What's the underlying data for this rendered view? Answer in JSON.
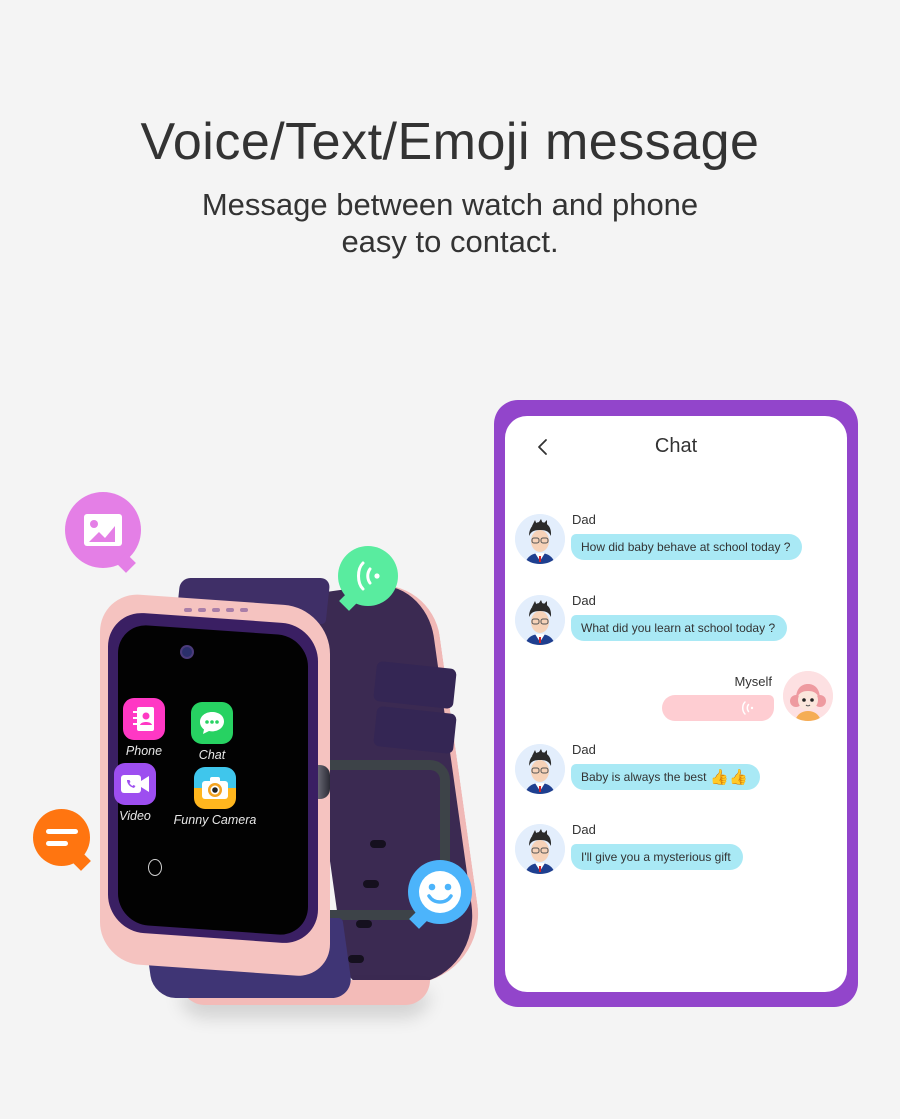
{
  "header": {
    "title": "Voice/Text/Emoji message",
    "subtitle_line1": "Message between watch and phone",
    "subtitle_line2": "easy to contact."
  },
  "watch": {
    "apps": [
      {
        "label": "Phone",
        "icon": "contacts-book-icon",
        "color": "#ff38c4"
      },
      {
        "label": "Chat",
        "icon": "chat-dots-icon",
        "color": "#27d262"
      },
      {
        "label": "Video",
        "icon": "video-call-icon",
        "color": "#9d4ef0"
      },
      {
        "label": "Funny Camera",
        "icon": "camera-icon",
        "color": "#3fc6ec"
      }
    ]
  },
  "floating_icons": [
    {
      "name": "image-message-icon",
      "color": "#e47fe6"
    },
    {
      "name": "voice-message-icon",
      "color": "#59ec9f"
    },
    {
      "name": "text-message-icon",
      "color": "#ff7510"
    },
    {
      "name": "emoji-message-icon",
      "color": "#4cb4fb"
    }
  ],
  "chat": {
    "title": "Chat",
    "back_icon": "chevron-left-icon",
    "frame_color": "#9245cb",
    "bubble_color": "#a9e9f5",
    "voice_bubble_color": "#fecdd2",
    "messages": [
      {
        "sender": "Dad",
        "side": "left",
        "type": "text",
        "text": "How did baby behave at school today ?"
      },
      {
        "sender": "Dad",
        "side": "left",
        "type": "text",
        "text": "What did you learn at school today ?"
      },
      {
        "sender": "Myself",
        "side": "right",
        "type": "voice",
        "text": ""
      },
      {
        "sender": "Dad",
        "side": "left",
        "type": "text",
        "text": "Baby is always the best",
        "emoji": "👍👍"
      },
      {
        "sender": "Dad",
        "side": "left",
        "type": "text",
        "text": "I'll give you a mysterious gift"
      }
    ]
  }
}
